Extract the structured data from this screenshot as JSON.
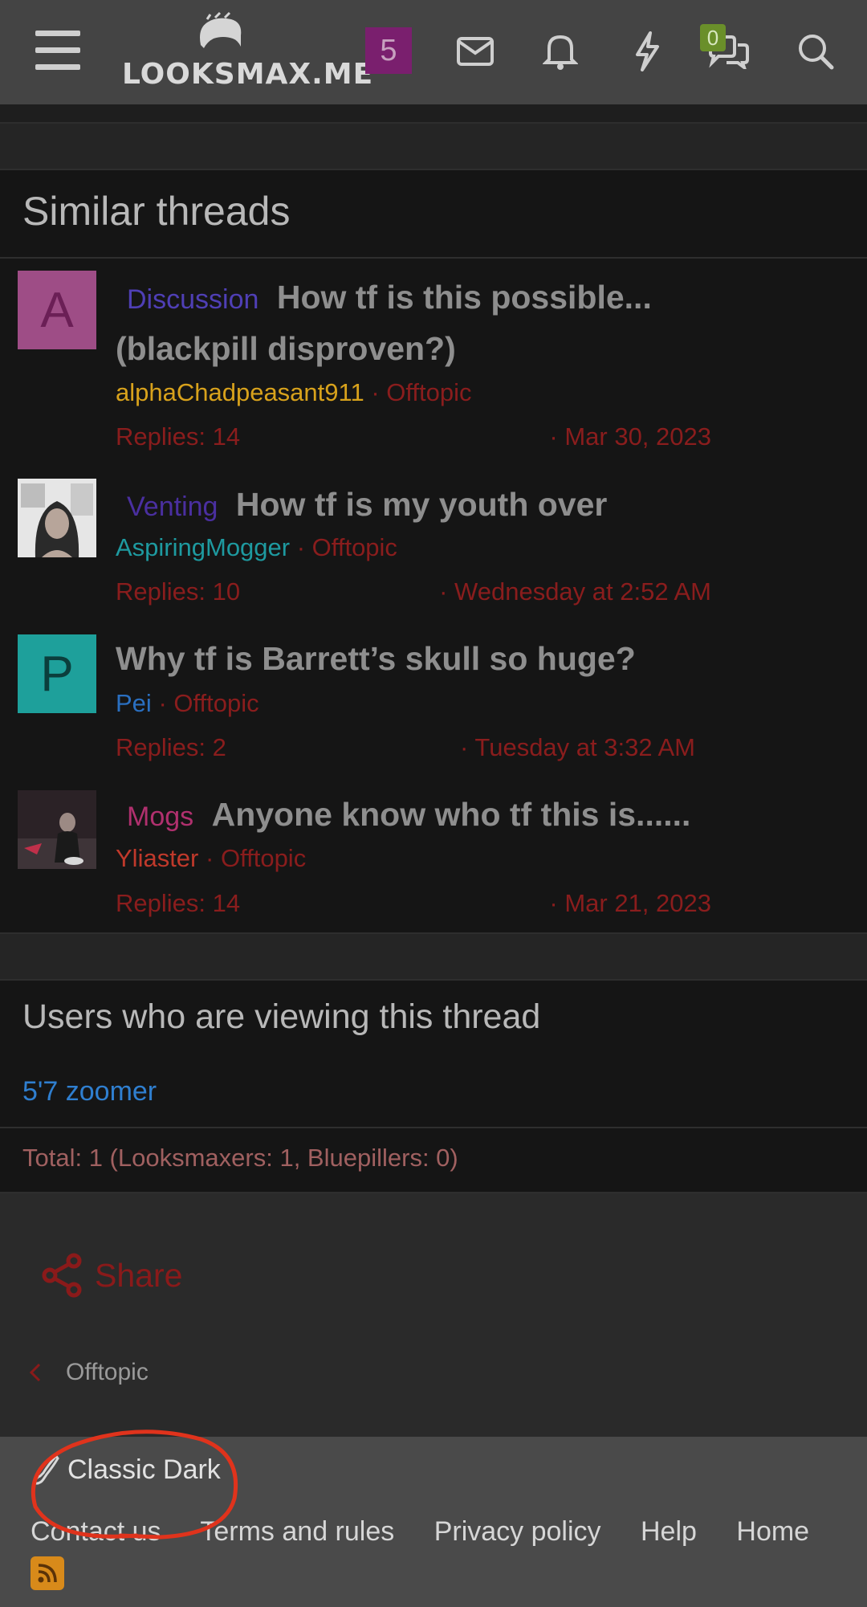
{
  "header": {
    "logo_text": "LOOKSMAX.ME",
    "notif_badge": "5",
    "conversations_count": "0",
    "icons": [
      "menu-icon",
      "mail-icon",
      "bell-icon",
      "lightning-icon",
      "chat-icon",
      "search-icon"
    ],
    "badge_color": "#7a1f6e"
  },
  "similar": {
    "title": "Similar threads",
    "threads": [
      {
        "avatar_letter": "A",
        "avatar_color": "#9e4d86",
        "avatar_text_color": "#6b1f56",
        "prefix": "Discussion",
        "prefix_color": "#4f3fb5",
        "title_line1": "How tf is this possible...",
        "title_line2": "(blackpill disproven?)",
        "author": "alphaChadpeasant911",
        "author_color": "#d8a21c",
        "forum": "Offtopic",
        "replies": "Replies: 14",
        "date": "Mar 30, 2023"
      },
      {
        "avatar_letter": "",
        "avatar_color": "#8a8a8a",
        "prefix": "Venting",
        "prefix_color": "#4a2fa0",
        "title_line1": "How tf is my youth over",
        "author": "AspiringMogger",
        "author_color": "#1e9aa0",
        "forum": "Offtopic",
        "replies": "Replies: 10",
        "date": "Wednesday at 2:52 AM"
      },
      {
        "avatar_letter": "P",
        "avatar_color": "#1ea09b",
        "avatar_text_color": "#0b3e3c",
        "prefix": "",
        "title_line1": "Why tf is Barrett’s skull so huge?",
        "author": "Pei",
        "author_color": "#2a6fc0",
        "forum": "Offtopic",
        "replies": "Replies: 2",
        "date": "Tuesday at 3:32 AM"
      },
      {
        "avatar_letter": "",
        "avatar_color": "#3a2a2a",
        "prefix": "Mogs",
        "prefix_color": "#b0306e",
        "title_line1": "Anyone know who tf this is......",
        "author": "Yliaster",
        "author_color": "#c0392b",
        "forum": "Offtopic",
        "replies": "Replies: 14",
        "date": "Mar 21, 2023"
      }
    ]
  },
  "viewing": {
    "title": "Users who are viewing this thread",
    "user": "5'7 zoomer",
    "total": "Total: 1 (Looksmaxers: 1, Bluepillers: 0)"
  },
  "share_label": "Share",
  "breadcrumb": "Offtopic",
  "footer": {
    "style": "Classic Dark",
    "links": [
      "Contact us",
      "Terms and rules",
      "Privacy policy",
      "Help",
      "Home"
    ]
  }
}
